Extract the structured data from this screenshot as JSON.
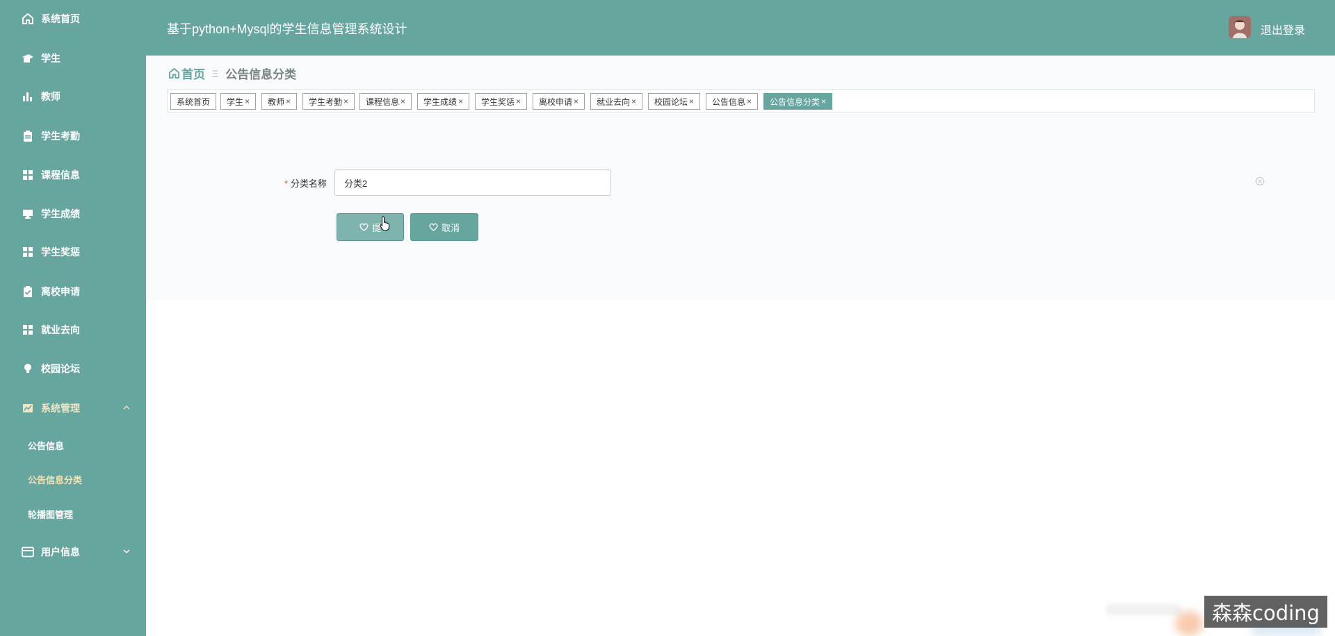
{
  "header": {
    "title": "基于python+Mysql的学生信息管理系统设计",
    "logout_label": "退出登录"
  },
  "sidebar": {
    "items": [
      {
        "label": "系统首页",
        "icon": "home-icon"
      },
      {
        "label": "学生",
        "icon": "graduation-cap-icon"
      },
      {
        "label": "教师",
        "icon": "bar-chart-icon"
      },
      {
        "label": "学生考勤",
        "icon": "clipboard-icon"
      },
      {
        "label": "课程信息",
        "icon": "grid-icon"
      },
      {
        "label": "学生成绩",
        "icon": "monitor-icon"
      },
      {
        "label": "学生奖惩",
        "icon": "grid-icon"
      },
      {
        "label": "离校申请",
        "icon": "clipboard-check-icon"
      },
      {
        "label": "就业去向",
        "icon": "grid-icon"
      },
      {
        "label": "校园论坛",
        "icon": "bulb-icon"
      },
      {
        "label": "系统管理",
        "icon": "chart-box-icon"
      },
      {
        "label": "用户信息",
        "icon": "id-card-icon"
      }
    ],
    "system_submenu": [
      {
        "label": "公告信息"
      },
      {
        "label": "公告信息分类"
      },
      {
        "label": "轮播图管理"
      }
    ]
  },
  "breadcrumb": {
    "home": "首页",
    "separator": "Ξ",
    "current": "公告信息分类"
  },
  "tags": [
    {
      "label": "系统首页",
      "closable": false
    },
    {
      "label": "学生",
      "closable": true
    },
    {
      "label": "教师",
      "closable": true
    },
    {
      "label": "学生考勤",
      "closable": true
    },
    {
      "label": "课程信息",
      "closable": true
    },
    {
      "label": "学生成绩",
      "closable": true
    },
    {
      "label": "学生奖惩",
      "closable": true
    },
    {
      "label": "离校申请",
      "closable": true
    },
    {
      "label": "就业去向",
      "closable": true
    },
    {
      "label": "校园论坛",
      "closable": true
    },
    {
      "label": "公告信息",
      "closable": true
    },
    {
      "label": "公告信息分类",
      "closable": true,
      "active": true
    }
  ],
  "form": {
    "required_mark": "*",
    "category_label": "分类名称",
    "category_value": "分类2",
    "submit_label": "提交",
    "submit_visible": "提",
    "cancel_label": "取消"
  },
  "watermark": "森森coding",
  "colors": {
    "primary": "#67a59f",
    "active_text": "#f4e2b3",
    "required": "#e0553e"
  }
}
